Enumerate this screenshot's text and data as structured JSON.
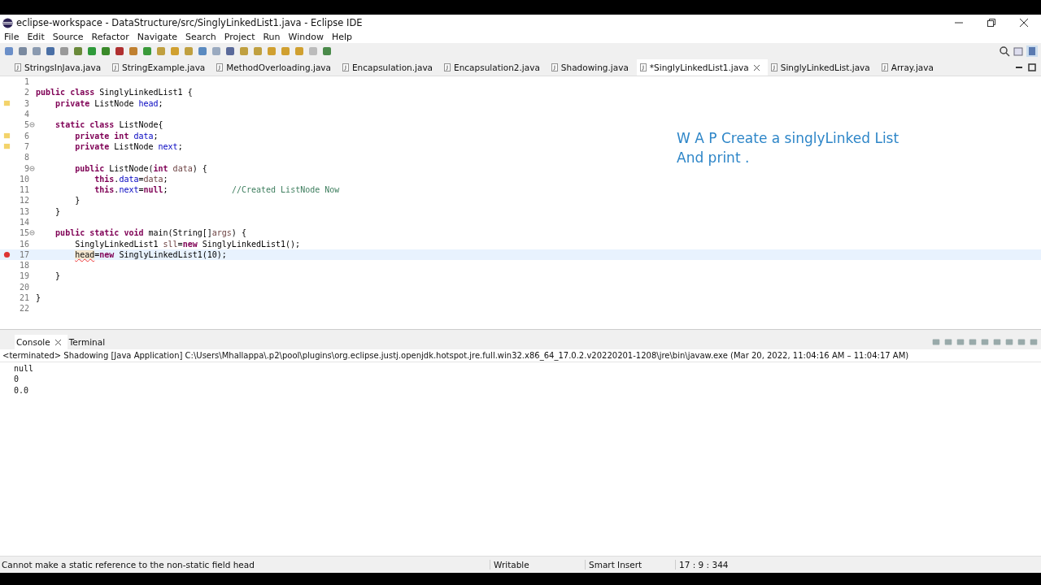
{
  "window": {
    "title": "eclipse-workspace - DataStructure/src/SinglyLinkedList1.java - Eclipse IDE"
  },
  "menu": [
    "File",
    "Edit",
    "Source",
    "Refactor",
    "Navigate",
    "Search",
    "Project",
    "Run",
    "Window",
    "Help"
  ],
  "editor_tabs": [
    {
      "label": "StringsInJava.java",
      "selected": false
    },
    {
      "label": "StringExample.java",
      "selected": false
    },
    {
      "label": "MethodOverloading.java",
      "selected": false
    },
    {
      "label": "Encapsulation.java",
      "selected": false
    },
    {
      "label": "Encapsulation2.java",
      "selected": false
    },
    {
      "label": "Shadowing.java",
      "selected": false
    },
    {
      "label": "*SinglyLinkedList1.java",
      "selected": true
    },
    {
      "label": "SinglyLinkedList.java",
      "selected": false
    },
    {
      "label": "Array.java",
      "selected": false
    }
  ],
  "code_lines": [
    {
      "number": "1",
      "warning": false,
      "error": false,
      "foldable": false,
      "current": false
    },
    {
      "number": "2",
      "warning": false,
      "error": false,
      "foldable": false,
      "current": false,
      "tokens": [
        {
          "kind": "kw",
          "text": "public class "
        },
        {
          "kind": "plain",
          "text": "SinglyLinkedList1 {"
        }
      ]
    },
    {
      "number": "3",
      "warning": true,
      "error": false,
      "foldable": false,
      "current": false,
      "tokens": [
        {
          "kind": "kw",
          "text": "    private "
        },
        {
          "kind": "plain",
          "text": "ListNode "
        },
        {
          "kind": "field",
          "text": "head"
        },
        {
          "kind": "plain",
          "text": ";"
        }
      ]
    },
    {
      "number": "4",
      "warning": false,
      "error": false,
      "foldable": false,
      "current": false
    },
    {
      "number": "5",
      "warning": false,
      "error": false,
      "foldable": true,
      "current": false,
      "tokens": [
        {
          "kind": "kw",
          "text": "    static class "
        },
        {
          "kind": "plain",
          "text": "ListNode{"
        }
      ]
    },
    {
      "number": "6",
      "warning": true,
      "error": false,
      "foldable": false,
      "current": false,
      "tokens": [
        {
          "kind": "kw",
          "text": "        private int "
        },
        {
          "kind": "field",
          "text": "data"
        },
        {
          "kind": "plain",
          "text": ";"
        }
      ]
    },
    {
      "number": "7",
      "warning": true,
      "error": false,
      "foldable": false,
      "current": false,
      "tokens": [
        {
          "kind": "kw",
          "text": "        private "
        },
        {
          "kind": "plain",
          "text": "ListNode "
        },
        {
          "kind": "field",
          "text": "next"
        },
        {
          "kind": "plain",
          "text": ";"
        }
      ]
    },
    {
      "number": "8",
      "warning": false,
      "error": false,
      "foldable": false,
      "current": false
    },
    {
      "number": "9",
      "warning": false,
      "error": false,
      "foldable": true,
      "current": false,
      "tokens": [
        {
          "kind": "kw",
          "text": "        public "
        },
        {
          "kind": "plain",
          "text": "ListNode("
        },
        {
          "kind": "kw",
          "text": "int "
        },
        {
          "kind": "var",
          "text": "data"
        },
        {
          "kind": "plain",
          "text": ") {"
        }
      ]
    },
    {
      "number": "10",
      "warning": false,
      "error": false,
      "foldable": false,
      "current": false,
      "tokens": [
        {
          "kind": "kw",
          "text": "            this"
        },
        {
          "kind": "plain",
          "text": "."
        },
        {
          "kind": "field",
          "text": "data"
        },
        {
          "kind": "plain",
          "text": "="
        },
        {
          "kind": "var",
          "text": "data"
        },
        {
          "kind": "plain",
          "text": ";"
        }
      ]
    },
    {
      "number": "11",
      "warning": false,
      "error": false,
      "foldable": false,
      "current": false,
      "tokens": [
        {
          "kind": "kw",
          "text": "            this"
        },
        {
          "kind": "plain",
          "text": "."
        },
        {
          "kind": "field",
          "text": "next"
        },
        {
          "kind": "plain",
          "text": "="
        },
        {
          "kind": "kw",
          "text": "null"
        },
        {
          "kind": "plain",
          "text": ";             "
        },
        {
          "kind": "comment",
          "text": "//Created ListNode Now"
        }
      ]
    },
    {
      "number": "12",
      "warning": false,
      "error": false,
      "foldable": false,
      "current": false,
      "tokens": [
        {
          "kind": "plain",
          "text": "        }"
        }
      ]
    },
    {
      "number": "13",
      "warning": false,
      "error": false,
      "foldable": false,
      "current": false,
      "tokens": [
        {
          "kind": "plain",
          "text": "    }"
        }
      ]
    },
    {
      "number": "14",
      "warning": false,
      "error": false,
      "foldable": false,
      "current": false
    },
    {
      "number": "15",
      "warning": false,
      "error": false,
      "foldable": true,
      "current": false,
      "tokens": [
        {
          "kind": "kw",
          "text": "    public static void "
        },
        {
          "kind": "plain",
          "text": "main(String[]"
        },
        {
          "kind": "var",
          "text": "args"
        },
        {
          "kind": "plain",
          "text": ") {"
        }
      ]
    },
    {
      "number": "16",
      "warning": false,
      "error": false,
      "foldable": false,
      "current": false,
      "tokens": [
        {
          "kind": "plain",
          "text": "        SinglyLinkedList1 "
        },
        {
          "kind": "var",
          "text": "sll"
        },
        {
          "kind": "plain",
          "text": "="
        },
        {
          "kind": "kw",
          "text": "new "
        },
        {
          "kind": "plain",
          "text": "SinglyLinkedList1();"
        }
      ]
    },
    {
      "number": "17",
      "warning": false,
      "error": true,
      "foldable": false,
      "current": true,
      "tokens": [
        {
          "kind": "error",
          "text": "        head"
        },
        {
          "kind": "plain",
          "text": "="
        },
        {
          "kind": "kw",
          "text": "new "
        },
        {
          "kind": "plain",
          "text": "SinglyLinkedList1(10);"
        }
      ]
    },
    {
      "number": "18",
      "warning": false,
      "error": false,
      "foldable": false,
      "current": false
    },
    {
      "number": "19",
      "warning": false,
      "error": false,
      "foldable": false,
      "current": false,
      "tokens": [
        {
          "kind": "plain",
          "text": "    }"
        }
      ]
    },
    {
      "number": "20",
      "warning": false,
      "error": false,
      "foldable": false,
      "current": false
    },
    {
      "number": "21",
      "warning": false,
      "error": false,
      "foldable": false,
      "current": false,
      "tokens": [
        {
          "kind": "plain",
          "text": "}"
        }
      ]
    },
    {
      "number": "22",
      "warning": false,
      "error": false,
      "foldable": false,
      "current": false
    }
  ],
  "annotation": "W A P Create a singlyLinked List And print .",
  "console_tabs": [
    {
      "label": "Console",
      "selected": true
    },
    {
      "label": "Terminal",
      "selected": false
    }
  ],
  "console_header": "<terminated> Shadowing [Java Application] C:\\Users\\Mhallappa\\.p2\\pool\\plugins\\org.eclipse.justj.openjdk.hotspot.jre.full.win32.x86_64_17.0.2.v20220201-1208\\jre\\bin\\javaw.exe  (Mar 20, 2022, 11:04:16 AM – 11:04:17 AM)",
  "console_output": [
    "null",
    "0",
    "0.0"
  ],
  "status_bar": {
    "message": "Cannot make a static reference to the non-static field head",
    "mode": "Writable",
    "insert": "Smart Insert",
    "position": "17 : 9 : 344"
  }
}
